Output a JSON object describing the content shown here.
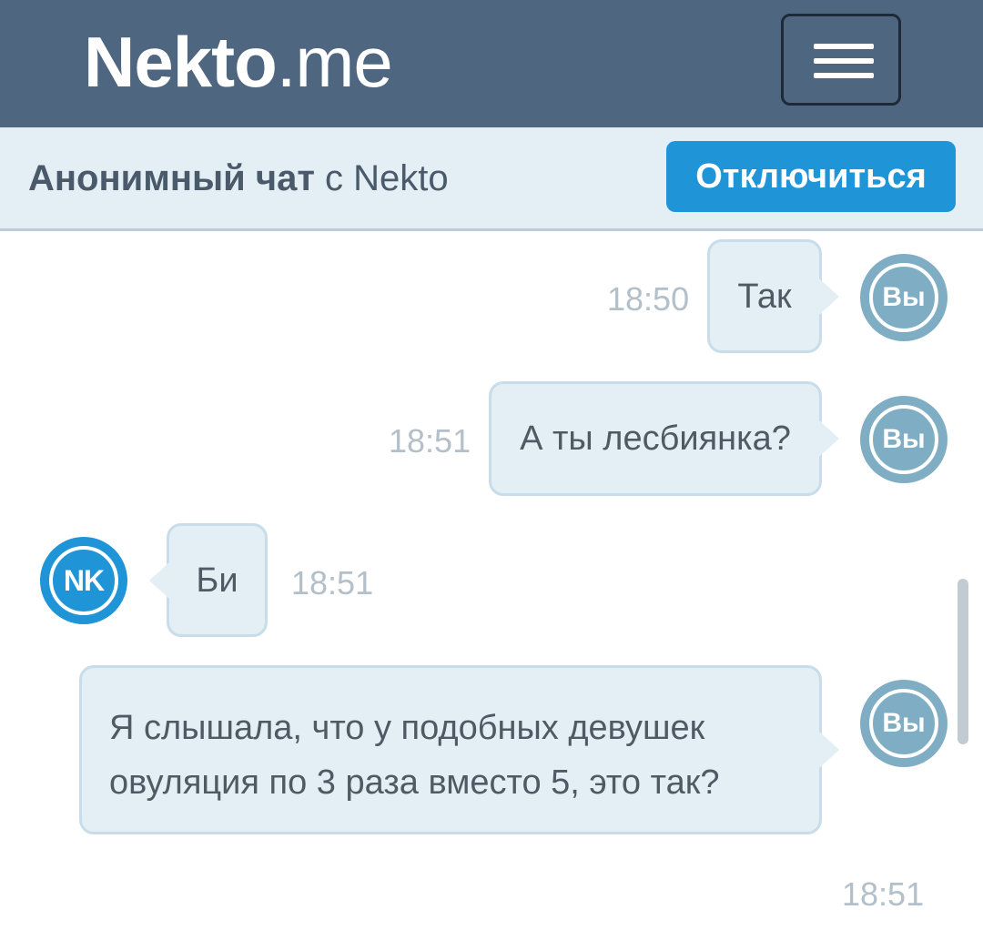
{
  "header": {
    "brand_bold": "Nekto",
    "brand_light": ".me",
    "menu_icon": "hamburger-menu-icon"
  },
  "subheader": {
    "title_bold": "Анонимный чат",
    "title_rest": " с Nekto",
    "disconnect_label": "Отключиться"
  },
  "messages": [
    {
      "sender": "me",
      "text": "Так",
      "time": "18:50",
      "avatar": "Вы"
    },
    {
      "sender": "me",
      "text": "А ты лесбиянка?",
      "time": "18:51",
      "avatar": "Вы"
    },
    {
      "sender": "partner",
      "text": "Би",
      "time": "18:51",
      "avatar": "NK"
    },
    {
      "sender": "me",
      "text_line1": "Я слышала, что у подобных девушек",
      "text_line2": "овуляция по 3 раза вместо 5, это так?",
      "time": "18:51",
      "avatar": "Вы"
    }
  ],
  "colors": {
    "header_bg": "#4e6680",
    "subheader_bg": "#e3eef5",
    "accent": "#1f94d6",
    "bubble_bg": "#e3eef5",
    "my_avatar": "#7faec4"
  }
}
